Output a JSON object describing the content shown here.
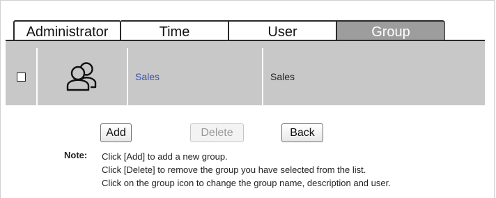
{
  "tabs": [
    {
      "label": "Administrator",
      "active": false
    },
    {
      "label": "Time",
      "active": false
    },
    {
      "label": "User",
      "active": false
    },
    {
      "label": "Group",
      "active": true
    }
  ],
  "table": {
    "rows": [
      {
        "checked": false,
        "icon": "group-icon",
        "name": "Sales",
        "description": "Sales"
      }
    ]
  },
  "buttons": {
    "add": "Add",
    "delete": "Delete",
    "back": "Back"
  },
  "note": {
    "label": "Note:",
    "lines": [
      "Click [Add] to add a new group.",
      "Click [Delete] to remove the group you have selected from the list.",
      "Click on the group icon to change the group name, description and user."
    ]
  },
  "colors": {
    "active_tab_bg": "#9d9d9d",
    "row_bg": "#c8c8c8",
    "link": "#3a4fa8"
  }
}
